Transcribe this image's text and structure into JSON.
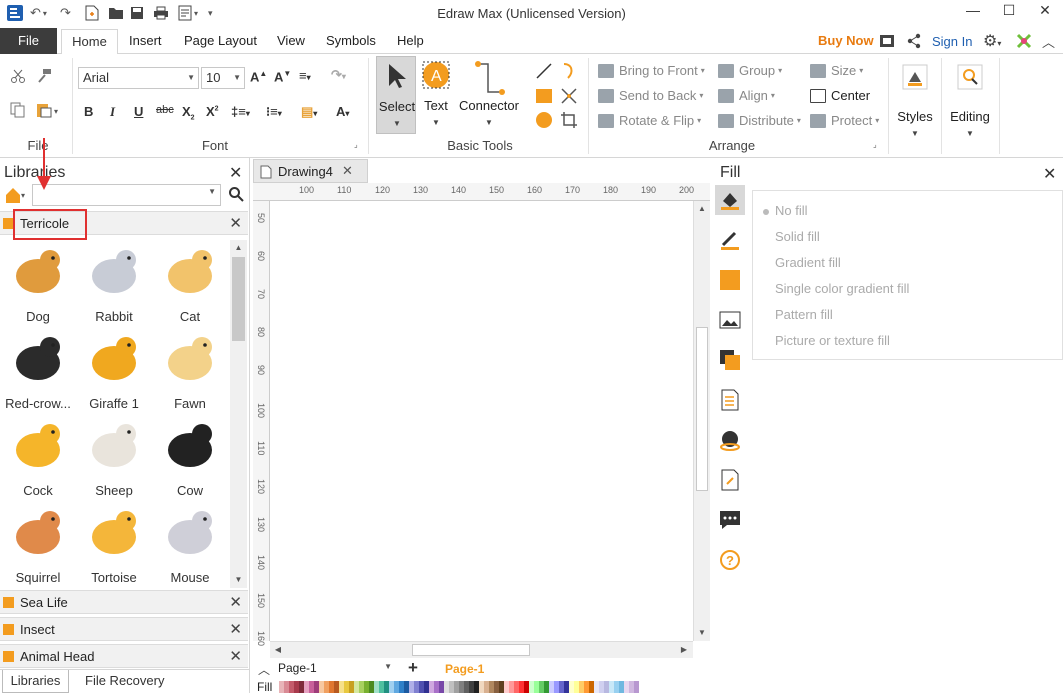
{
  "window": {
    "title": "Edraw Max (Unlicensed Version)"
  },
  "menu": {
    "file": "File",
    "tabs": [
      "Home",
      "Insert",
      "Page Layout",
      "View",
      "Symbols",
      "Help"
    ],
    "buy_now": "Buy Now",
    "sign_in": "Sign In"
  },
  "ribbon": {
    "file_group": "File",
    "font": {
      "family": "Arial",
      "size": "10",
      "group_label": "Font"
    },
    "basic_tools": {
      "select": "Select",
      "text": "Text",
      "connector": "Connector",
      "group_label": "Basic Tools"
    },
    "arrange": {
      "bring_to_front": "Bring to Front",
      "send_to_back": "Send to Back",
      "rotate_flip": "Rotate & Flip",
      "group": "Group",
      "align": "Align",
      "distribute": "Distribute",
      "size": "Size",
      "center": "Center",
      "protect": "Protect",
      "group_label": "Arrange"
    },
    "styles": "Styles",
    "editing": "Editing"
  },
  "libraries": {
    "title": "Libraries",
    "search_placeholder": "",
    "open_library": "Terricole",
    "shapes": [
      {
        "name": "Dog",
        "color": "#e09b3d"
      },
      {
        "name": "Rabbit",
        "color": "#c8ccd6"
      },
      {
        "name": "Cat",
        "color": "#f2c36b"
      },
      {
        "name": "Red-crow...",
        "color": "#2b2b2b"
      },
      {
        "name": "Giraffe 1",
        "color": "#f0a81f"
      },
      {
        "name": "Fawn",
        "color": "#f3d28a"
      },
      {
        "name": "Cock",
        "color": "#f5b52a"
      },
      {
        "name": "Sheep",
        "color": "#e9e4dc"
      },
      {
        "name": "Cow",
        "color": "#222222"
      },
      {
        "name": "Squirrel",
        "color": "#e08a4a"
      },
      {
        "name": "Tortoise",
        "color": "#f4b63a"
      },
      {
        "name": "Mouse",
        "color": "#cfcfd8"
      }
    ],
    "other_libraries": [
      "Sea Life",
      "Insect",
      "Animal Head"
    ],
    "bottom_tabs": [
      "Libraries",
      "File Recovery"
    ]
  },
  "document": {
    "tab_name": "Drawing4",
    "h_ruler_ticks": [
      "100",
      "110",
      "120",
      "130",
      "140",
      "150",
      "160",
      "170",
      "180",
      "190",
      "200"
    ],
    "v_ruler_ticks": [
      "50",
      "60",
      "70",
      "80",
      "90",
      "100",
      "110",
      "120",
      "130",
      "140",
      "150",
      "160"
    ],
    "page_select": "Page-1",
    "active_page": "Page-1",
    "fill_label": "Fill"
  },
  "fill_panel": {
    "title": "Fill",
    "options": [
      "No fill",
      "Solid fill",
      "Gradient fill",
      "Single color gradient fill",
      "Pattern fill",
      "Picture or texture fill"
    ]
  },
  "palette": [
    "#e8b4b8",
    "#d98a94",
    "#c45b6b",
    "#a83a4c",
    "#7f2a3a",
    "#e6a0c0",
    "#c8609a",
    "#9e3c7a",
    "#f7c8a0",
    "#f0a060",
    "#e07830",
    "#b85a20",
    "#f6e08a",
    "#e8c840",
    "#c8a020",
    "#d4e8a0",
    "#a8d060",
    "#78b030",
    "#4c8a20",
    "#a0e0c8",
    "#50c0a0",
    "#209080",
    "#a0d0f0",
    "#60a8e0",
    "#3080c8",
    "#1c5aa0",
    "#b0b0e8",
    "#8080d0",
    "#5050b0",
    "#303090",
    "#d0a8e0",
    "#a870c8",
    "#7848a8",
    "#e0e0e0",
    "#c0c0c0",
    "#a0a0a0",
    "#808080",
    "#606060",
    "#404040",
    "#202020",
    "#f0d8c0",
    "#d8b090",
    "#b08860",
    "#886040",
    "#604020",
    "#ffcccc",
    "#ff9999",
    "#ff6666",
    "#ff3333",
    "#cc0000",
    "#ccffcc",
    "#99ff99",
    "#66cc66",
    "#339933",
    "#ccccff",
    "#9999ff",
    "#6666cc",
    "#333399",
    "#ffffcc",
    "#ffff99",
    "#ffcc66",
    "#ff9933",
    "#cc6600",
    "#e8e8f8",
    "#d0d0f0",
    "#b8b8e0",
    "#c8e8f8",
    "#98d0f0",
    "#70b8e0",
    "#e8d8f0",
    "#d0b8e0",
    "#b898d0"
  ]
}
